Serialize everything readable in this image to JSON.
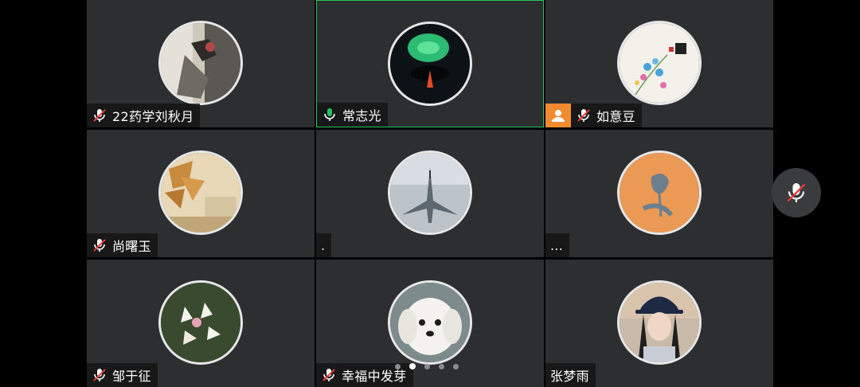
{
  "participants": [
    {
      "name": "22药学刘秋月",
      "mic": "muted",
      "avatar": "room-shadow"
    },
    {
      "name": "常志光",
      "mic": "active",
      "avatar": "lotus-leaf",
      "active": true
    },
    {
      "name": "如意豆",
      "mic": "muted",
      "avatar": "floral-reading",
      "host": true
    },
    {
      "name": "尚曙玉",
      "mic": "muted",
      "avatar": "autumn-leaves"
    },
    {
      "name": ".",
      "mic": "none",
      "avatar": "fighter-jet"
    },
    {
      "name": "...",
      "mic": "none",
      "avatar": "orange-rose"
    },
    {
      "name": "邹于征",
      "mic": "muted",
      "avatar": "white-lilies"
    },
    {
      "name": "幸福中发芽",
      "mic": "muted",
      "avatar": "white-puppy"
    },
    {
      "name": "张梦雨",
      "mic": "none",
      "avatar": "girl-cap"
    }
  ],
  "pagination": {
    "count": 5,
    "active_index": 1
  },
  "controls": {
    "floating_mic": "muted"
  },
  "colors": {
    "active_border": "#22c55e",
    "muted_red": "#e23b3b",
    "active_green": "#22c55e",
    "host_orange": "#f28a2e"
  }
}
